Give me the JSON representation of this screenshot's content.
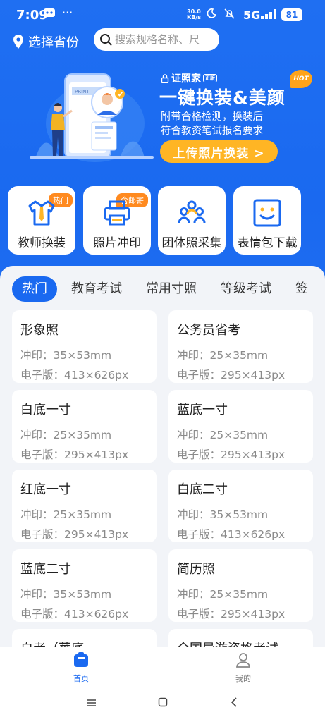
{
  "status": {
    "time": "7:09",
    "speed_top": "30.0",
    "speed_bottom": "KB/s",
    "network": "5G",
    "battery": "81"
  },
  "header": {
    "location_label": "选择省份",
    "search_placeholder": "搜索规格名称、尺"
  },
  "banner": {
    "brand": "证照家",
    "brand_tag": "正版",
    "title": "一键换装&美颜",
    "hot": "HOT",
    "subtitle_1": "附带合格检测，换装后",
    "subtitle_2": "符合教资笔试报名要求",
    "cta": "上传照片换装 >",
    "print_label": "PRINT"
  },
  "services": [
    {
      "label": "教师换装",
      "badge": "热门",
      "icon": "shirt-icon"
    },
    {
      "label": "照片冲印",
      "badge": "含邮寄",
      "icon": "printer-icon"
    },
    {
      "label": "团体照采集",
      "badge": "",
      "icon": "group-icon"
    },
    {
      "label": "表情包下载",
      "badge": "",
      "icon": "smiley-icon"
    }
  ],
  "tabs": [
    "热门",
    "教育考试",
    "常用寸照",
    "等级考试",
    "签"
  ],
  "cards": [
    {
      "title": "形象照",
      "print": "冲印：35×53mm",
      "digital": "电子版：413×626px"
    },
    {
      "title": "公务员省考",
      "print": "冲印：25×35mm",
      "digital": "电子版：295×413px"
    },
    {
      "title": "白底一寸",
      "print": "冲印：25×35mm",
      "digital": "电子版：295×413px"
    },
    {
      "title": "蓝底一寸",
      "print": "冲印：25×35mm",
      "digital": "电子版：295×413px"
    },
    {
      "title": "红底一寸",
      "print": "冲印：25×35mm",
      "digital": "电子版：295×413px"
    },
    {
      "title": "白底二寸",
      "print": "冲印：35×53mm",
      "digital": "电子版：413×626px"
    },
    {
      "title": "蓝底二寸",
      "print": "冲印：35×53mm",
      "digital": "电子版：413×626px"
    },
    {
      "title": "简历照",
      "print": "冲印：25×35mm",
      "digital": "电子版：295×413px"
    },
    {
      "title": "自考（華底",
      "print": "",
      "digital": ""
    },
    {
      "title": "全国导游资格考试",
      "print": "",
      "digital": ""
    }
  ],
  "bottom_nav": {
    "home": "首页",
    "mine": "我的"
  },
  "colors": {
    "primary": "#1a69f0",
    "accent": "#ffb524",
    "badge": "#ff8a1f"
  }
}
